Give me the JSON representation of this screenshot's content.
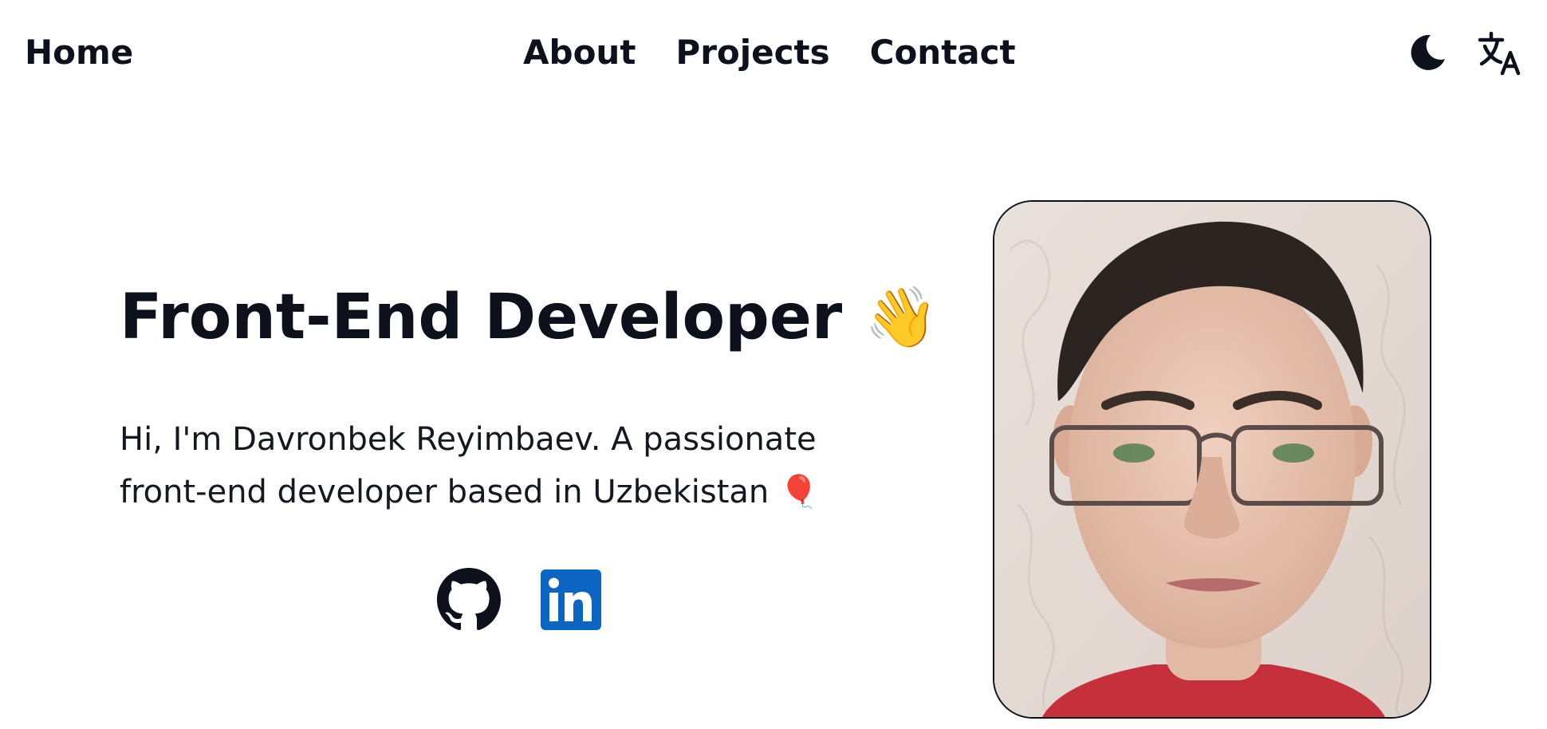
{
  "nav": {
    "home_label": "Home",
    "links": [
      {
        "label": "About"
      },
      {
        "label": "Projects"
      },
      {
        "label": "Contact"
      }
    ],
    "theme_icon": "moon-icon",
    "language_icon": "translate-icon"
  },
  "hero": {
    "title": "Front-End Developer",
    "title_emoji": "👋",
    "description": "Hi, I'm Davronbek Reyimbaev. A passionate front-end developer based in Uzbekistan 🎈",
    "social": [
      {
        "icon": "github-icon"
      },
      {
        "icon": "linkedin-icon",
        "color": "#0a66c2"
      }
    ]
  },
  "profile_photo": {
    "icon": "profile-photo"
  }
}
